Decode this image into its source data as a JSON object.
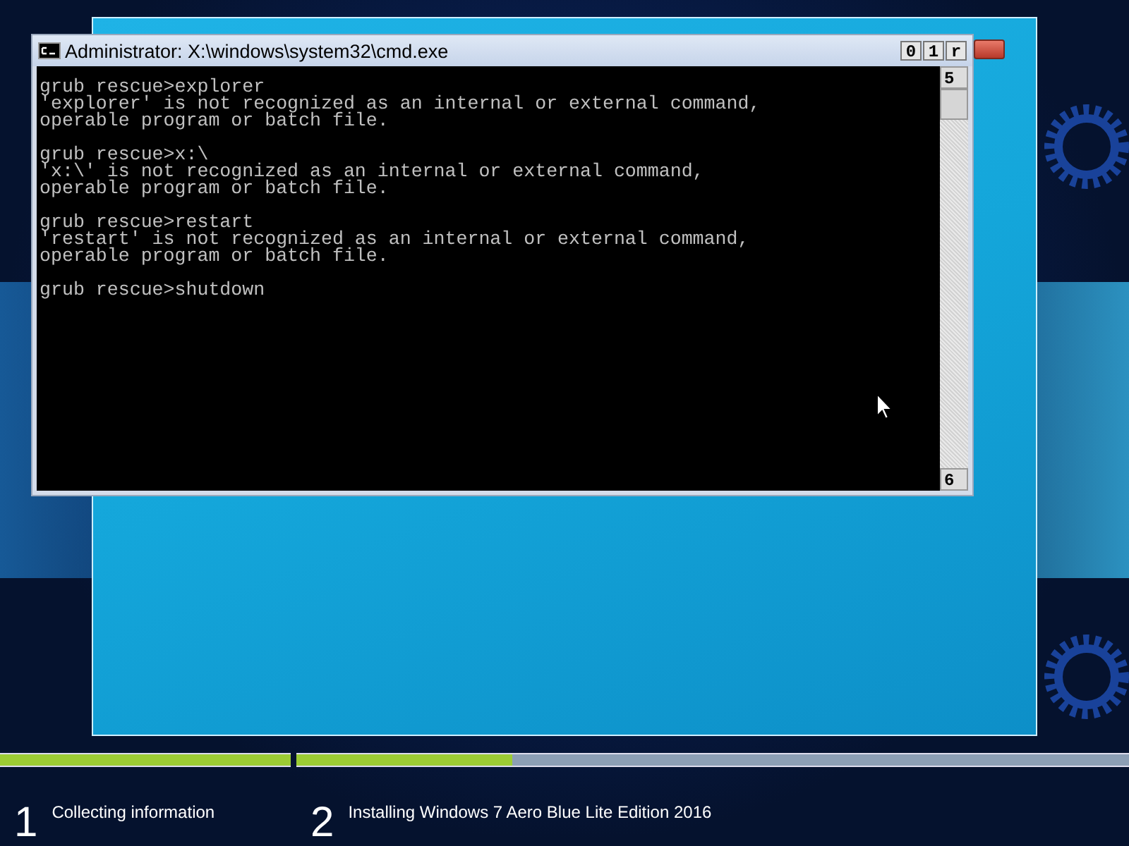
{
  "console_window": {
    "title": "Administrator: X:\\windows\\system32\\cmd.exe",
    "title_buttons": [
      "0",
      "1",
      "r"
    ],
    "scroll_up": "5",
    "scroll_down": "6",
    "sessions": [
      {
        "command": "grub rescue>explorer",
        "output": [
          "'explorer' is not recognized as an internal or external command,",
          "operable program or batch file."
        ]
      },
      {
        "command": "grub rescue>x:\\",
        "output": [
          "'x:\\' is not recognized as an internal or external command,",
          "operable program or batch file."
        ]
      },
      {
        "command": "grub rescue>restart",
        "output": [
          "'restart' is not recognized as an internal or external command,",
          "operable program or batch file."
        ]
      },
      {
        "command": "grub rescue>shutdown"
      }
    ]
  },
  "setup_steps": [
    {
      "number": "1",
      "label": "Collecting information",
      "level": 1
    },
    {
      "number": "2",
      "label": "Installing Windows 7 Aero Blue Lite Edition 2016",
      "level": 0.26
    }
  ]
}
